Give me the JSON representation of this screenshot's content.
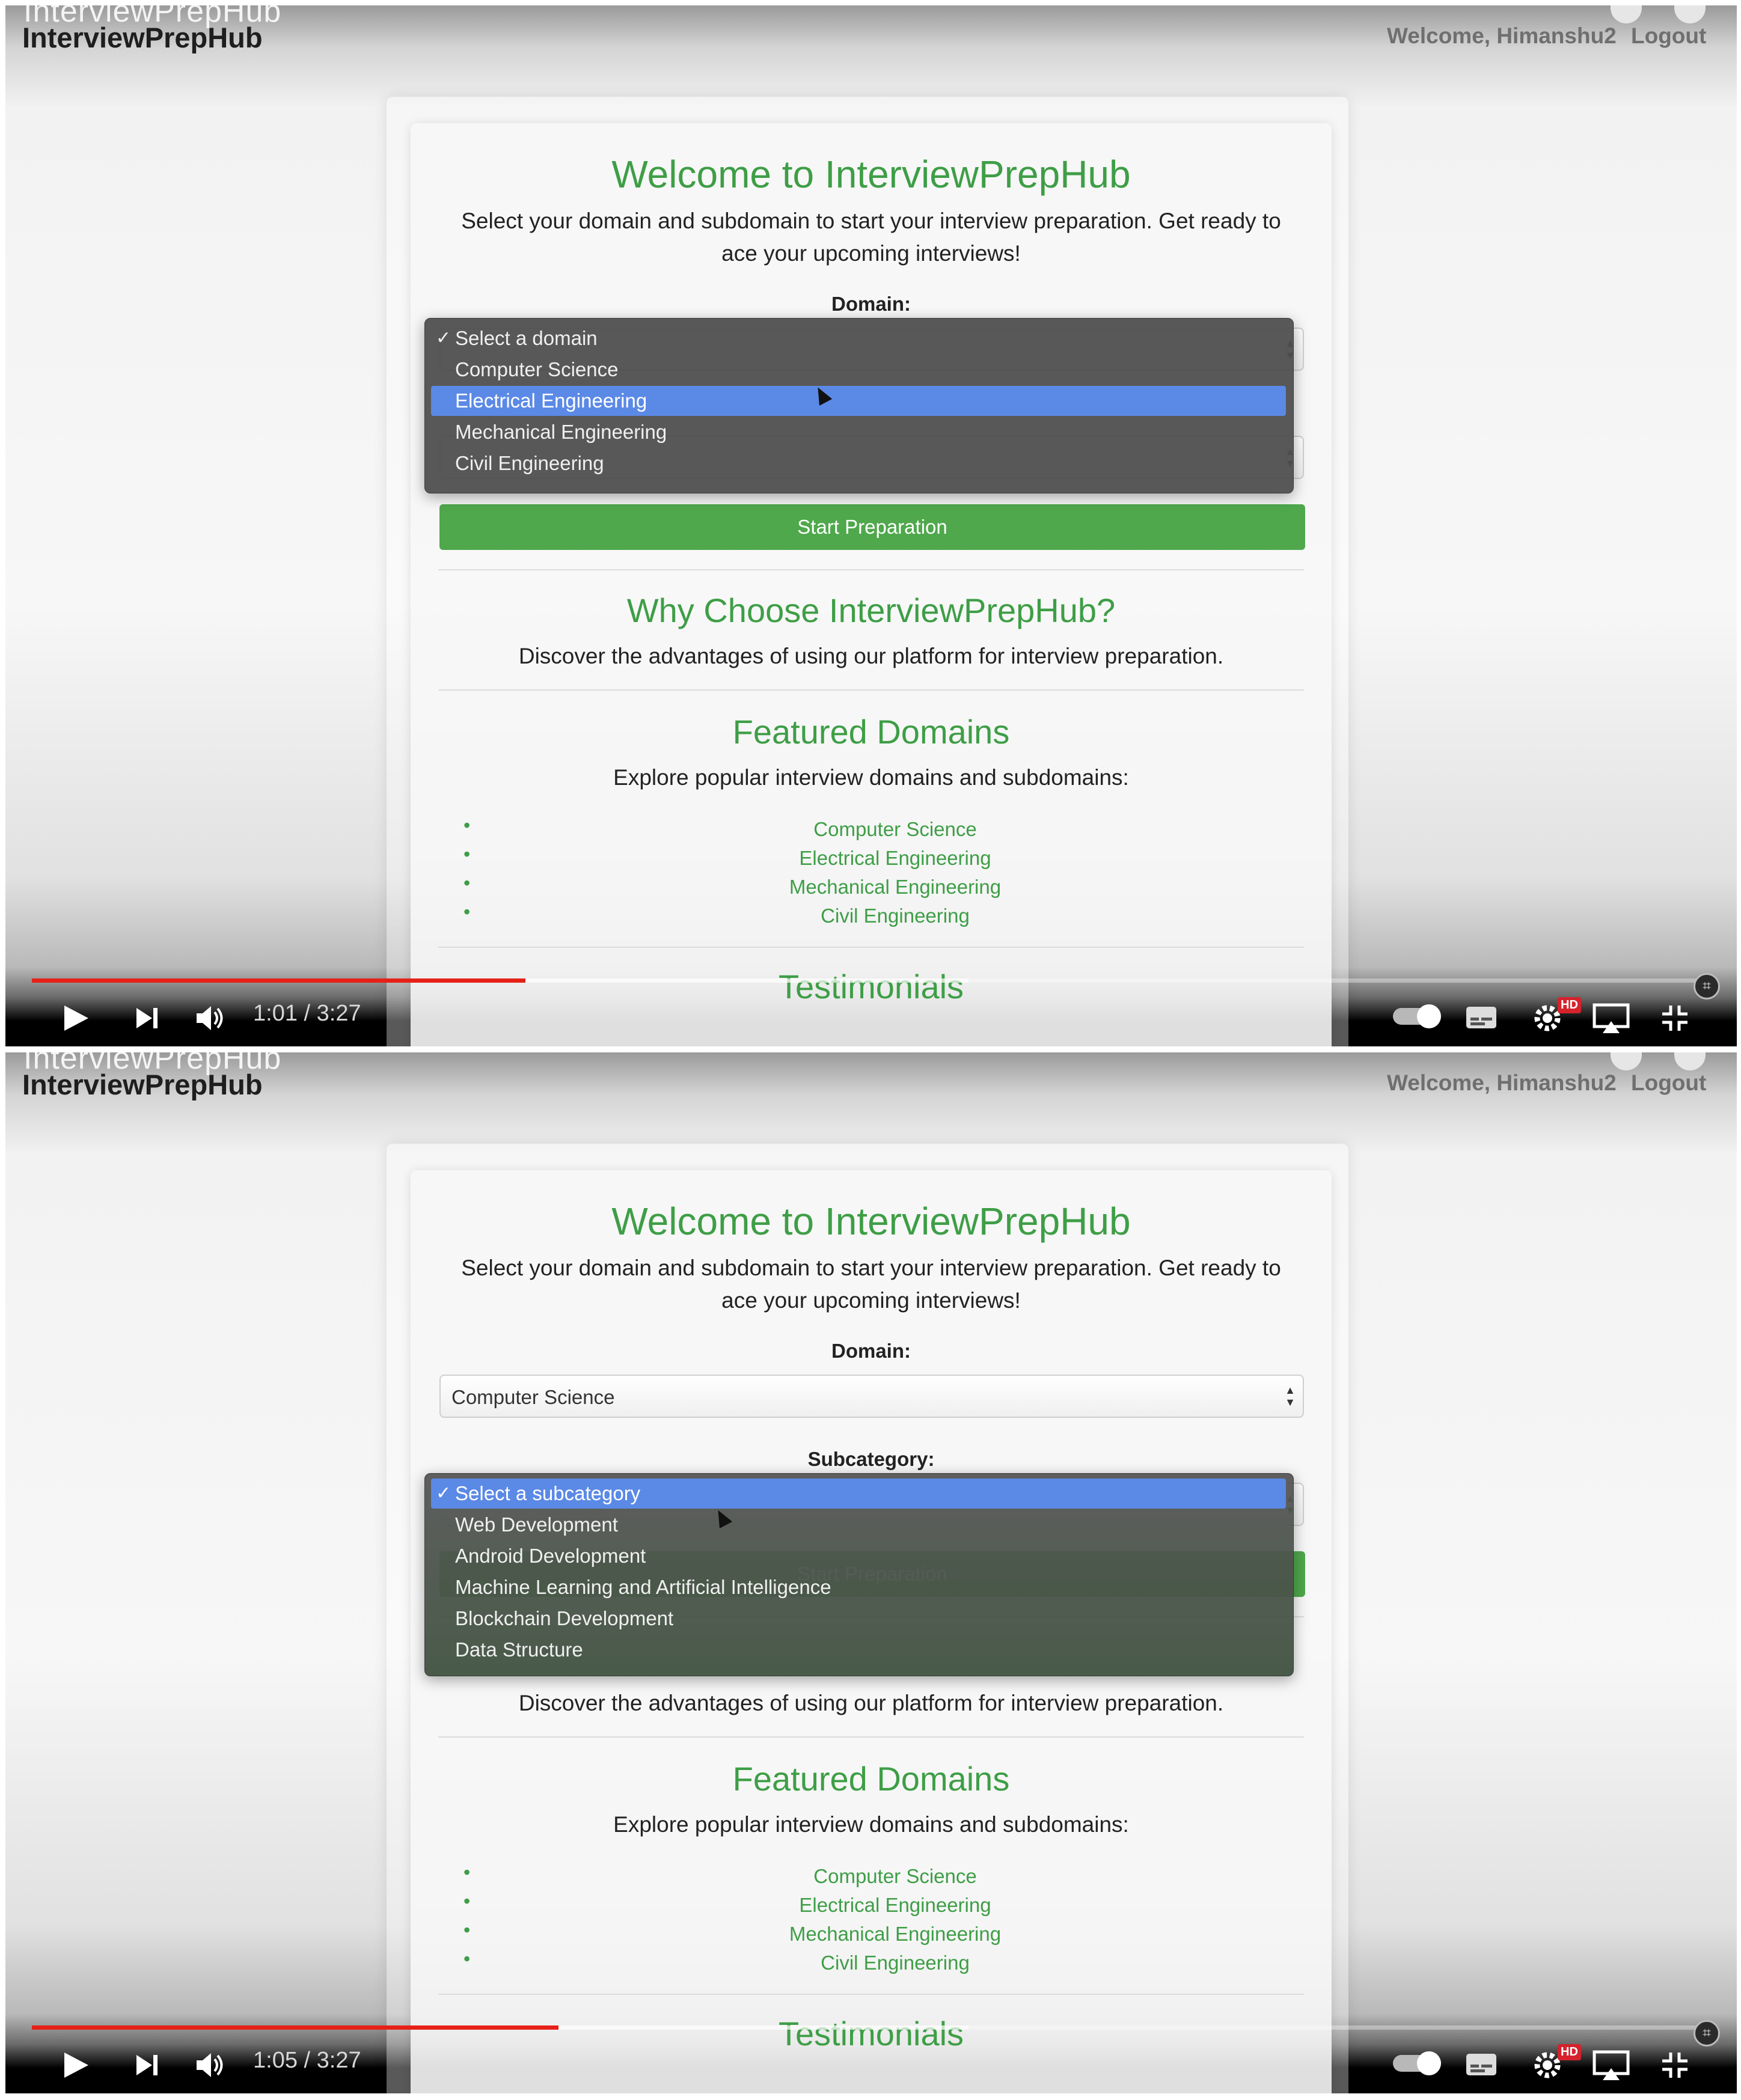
{
  "header": {
    "brand_ghost": "InterviewPrepHub",
    "brand": "InterviewPrepHub",
    "welcome": "Welcome, Himanshu2",
    "logout": "Logout"
  },
  "hero": {
    "title": "Welcome to InterviewPrepHub",
    "intro": "Select your domain and subdomain to start your interview preparation. Get ready to ace your upcoming interviews!"
  },
  "form": {
    "domain_label": "Domain:",
    "subcategory_label": "Subcategory:",
    "domain_selected": "Computer Science",
    "start_button": "Start Preparation"
  },
  "domain_options": [
    "Select a domain",
    "Computer Science",
    "Electrical Engineering",
    "Mechanical Engineering",
    "Civil Engineering"
  ],
  "subcategory_options": [
    "Select a subcategory",
    "Web Development",
    "Android Development",
    "Machine Learning and Artificial Intelligence",
    "Blockchain Development",
    "Data Structure"
  ],
  "why": {
    "title": "Why Choose InterviewPrepHub?",
    "text": "Discover the advantages of using our platform for interview preparation."
  },
  "featured": {
    "title": "Featured Domains",
    "text": "Explore popular interview domains and subdomains:",
    "items": [
      "Computer Science",
      "Electrical Engineering",
      "Mechanical Engineering",
      "Civil Engineering"
    ]
  },
  "testimonials_title": "Testimonials",
  "player": {
    "frame1_time": "1:01 / 3:27",
    "frame2_time": "1:05 / 3:27",
    "frame1_progress": 0.295,
    "frame2_progress": 0.315,
    "buffered": 0.56,
    "hd_badge": "HD",
    "accent": "#e62117"
  },
  "colors": {
    "brand_green": "#3e9e46",
    "button_green": "#4fa84c",
    "highlight_blue": "#5b89e6"
  },
  "icons": {
    "play": "play-icon",
    "next": "next-icon",
    "volume": "volume-icon",
    "autoplay": "autoplay-toggle",
    "subtitles": "subtitles-icon",
    "settings": "settings-gear-icon",
    "airplay": "airplay-icon",
    "exit_fullscreen": "exit-fullscreen-icon"
  }
}
